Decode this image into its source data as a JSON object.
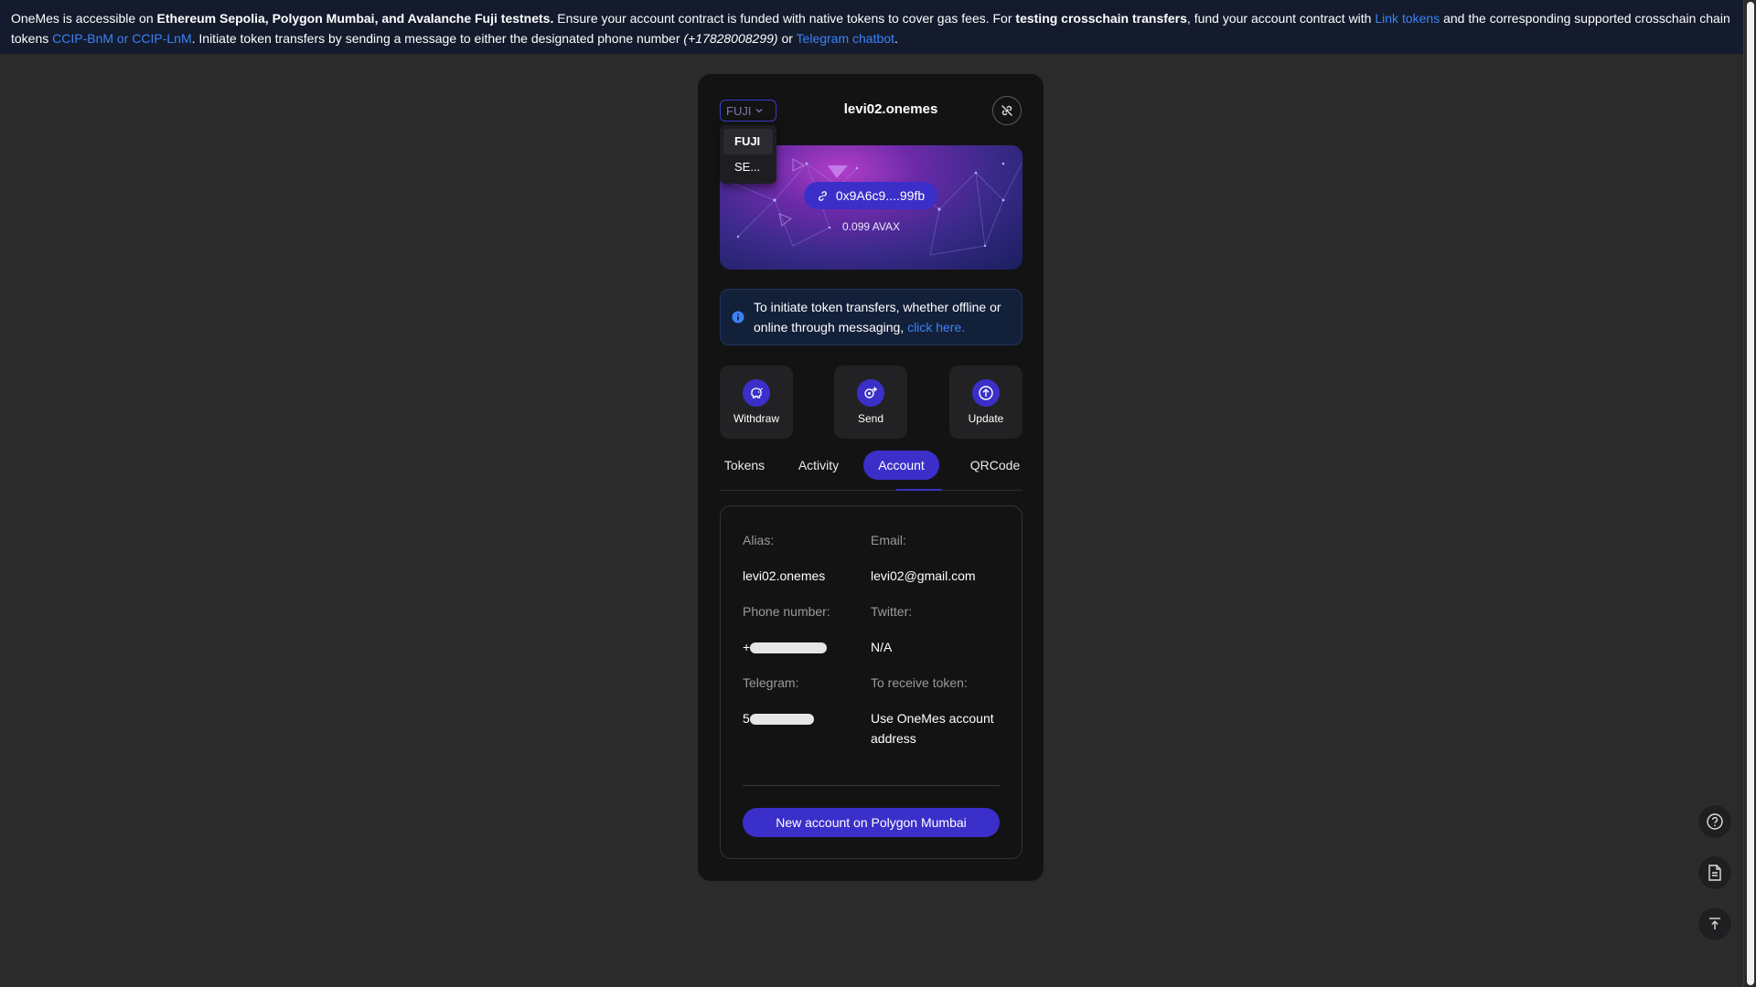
{
  "banner": {
    "t1": "OneMes is accessible on ",
    "b1": "Ethereum Sepolia, Polygon Mumbai, and Avalanche Fuji testnets.",
    "t2": " Ensure your account contract is funded with native tokens to cover gas fees. For ",
    "b2": "testing crosschain transfers",
    "t3": ", fund your account contract with ",
    "link1": "Link tokens",
    "t4": " and the corresponding supported crosschain chain tokens ",
    "link2": "CCIP-BnM or CCIP-LnM",
    "t5": ". Initiate token transfers by sending a message to either the designated phone number ",
    "phone": "(+17828008299)",
    "t6": " or ",
    "link3": "Telegram chatbot",
    "t7": "."
  },
  "wallet": {
    "network_selected": "FUJI",
    "network_options": [
      "FUJI",
      "SE..."
    ],
    "alias": "levi02.onemes",
    "address": "0x9A6c9....99fb",
    "balance": "0.099 AVAX",
    "info": {
      "text": "To initiate token transfers, whether offline or online through messaging, ",
      "link": "click here."
    },
    "actions": {
      "withdraw": "Withdraw",
      "send": "Send",
      "update": "Update"
    },
    "tabs": {
      "tokens": "Tokens",
      "activity": "Activity",
      "account": "Account",
      "qrcode": "QRCode"
    },
    "account": {
      "alias_label": "Alias:",
      "alias_value": "levi02.onemes",
      "email_label": "Email:",
      "email_value": "levi02@gmail.com",
      "phone_label": "Phone number:",
      "phone_prefix": "+",
      "twitter_label": "Twitter:",
      "twitter_value": "N/A",
      "telegram_label": "Telegram:",
      "telegram_prefix": "5",
      "receive_label": "To receive token:",
      "receive_value": "Use OneMes account address",
      "new_account_button": "New account on Polygon Mumbai"
    }
  },
  "colors": {
    "accent": "#3b2fc9",
    "link": "#3b82f6",
    "card_bg": "#131313",
    "page_bg": "#2b2b2c"
  },
  "icons": [
    "chevron-down-icon",
    "disconnect-icon",
    "link-icon",
    "info-icon",
    "piggy-bank-icon",
    "send-icon",
    "upload-icon",
    "help-icon",
    "document-icon",
    "scroll-top-icon"
  ]
}
